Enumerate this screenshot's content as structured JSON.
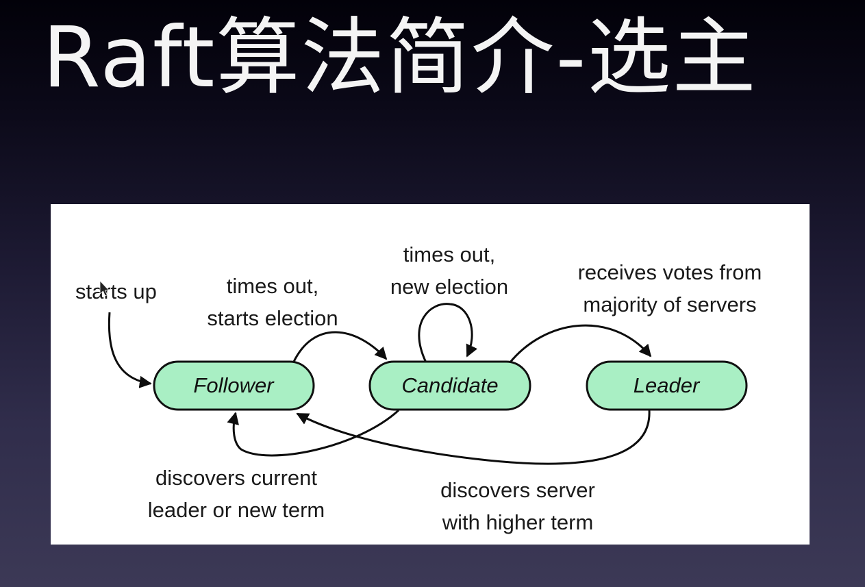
{
  "title": "Raft算法简介-选主",
  "diagram": {
    "states": {
      "follower": "Follower",
      "candidate": "Candidate",
      "leader": "Leader"
    },
    "transitions": {
      "starts_up": "starts up",
      "follower_to_candidate": [
        "times out,",
        "starts election"
      ],
      "candidate_to_candidate": [
        "times out,",
        "new election"
      ],
      "candidate_to_leader": [
        "receives votes from",
        "majority of servers"
      ],
      "candidate_to_follower": [
        "discovers current",
        "leader or new term"
      ],
      "leader_to_follower": [
        "discovers server",
        "with higher term"
      ]
    },
    "colors": {
      "state_fill": "#a9efc4",
      "panel_background": "#ffffff",
      "slide_background": "#1d1a33"
    }
  },
  "icons": {
    "cursor": "mouse-pointer-icon"
  }
}
